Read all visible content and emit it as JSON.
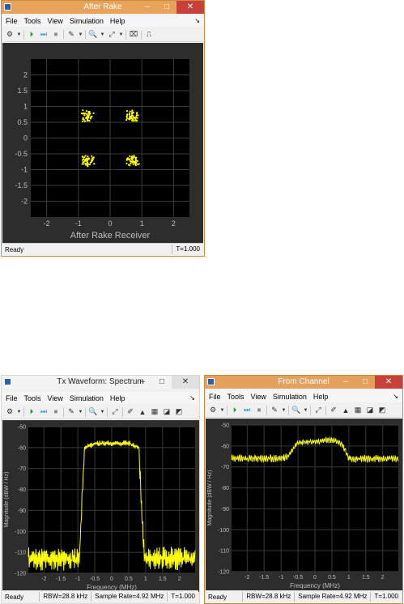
{
  "rake": {
    "title": "After Rake",
    "menu": [
      "File",
      "Tools",
      "View",
      "Simulation",
      "Help"
    ],
    "status": {
      "ready": "Ready",
      "time": "T=1.000"
    },
    "xlabel": "After Rake Receiver",
    "xticks": [
      "-2",
      "-1",
      "0",
      "1",
      "2"
    ],
    "yticks": [
      "2",
      "1.5",
      "1",
      "0.5",
      "0",
      "-0.5",
      "-1",
      "-1.5",
      "-2"
    ],
    "clusters": [
      {
        "x": -0.7,
        "y": 0.7
      },
      {
        "x": 0.7,
        "y": 0.7
      },
      {
        "x": -0.7,
        "y": -0.7
      },
      {
        "x": 0.7,
        "y": -0.7
      }
    ],
    "color": "#ffff00"
  },
  "tx": {
    "title": "Tx Waveform: Spectrum",
    "menu": [
      "File",
      "Tools",
      "View",
      "Simulation",
      "Help"
    ],
    "status": {
      "ready": "Ready",
      "rbw": "RBW=28.8 kHz",
      "rate": "Sample Rate=4.92 MHz",
      "time": "T=1.000"
    },
    "xlabel": "Frequency (MHz)",
    "ylabel": "Magnitude (dBW / Hz)",
    "xticks": [
      "-2",
      "-1.5",
      "-1",
      "-0.5",
      "0",
      "0.5",
      "1",
      "1.5",
      "2"
    ],
    "yticks": [
      "-50",
      "-60",
      "-70",
      "-80",
      "-90",
      "-100",
      "-110",
      "-120"
    ]
  },
  "ch": {
    "title": "From Channel",
    "menu": [
      "File",
      "Tools",
      "View",
      "Simulation",
      "Help"
    ],
    "status": {
      "ready": "Ready",
      "rbw": "RBW=28.8 kHz",
      "rate": "Sample Rate=4.92 MHz",
      "time": "T=1.000"
    },
    "xlabel": "Frequency (MHz)",
    "ylabel": "Magnitude (dBW / Hz)",
    "xticks": [
      "-2",
      "-1.5",
      "-1",
      "-0.5",
      "0",
      "0.5",
      "1",
      "1.5",
      "2"
    ],
    "yticks": [
      "-50",
      "-60",
      "-70",
      "-80",
      "-90",
      "-100",
      "-110",
      "-120"
    ]
  },
  "chart_data": [
    {
      "type": "scatter",
      "title": "",
      "xlabel": "After Rake Receiver",
      "ylabel": "",
      "xlim": [
        -2.5,
        2.5
      ],
      "ylim": [
        -2.5,
        2.5
      ],
      "series": [
        {
          "points_centers": [
            [
              -0.7,
              0.7
            ],
            [
              0.7,
              0.7
            ],
            [
              -0.7,
              -0.7
            ],
            [
              0.7,
              -0.7
            ]
          ]
        }
      ]
    },
    {
      "type": "line",
      "title": "",
      "xlabel": "Frequency (MHz)",
      "ylabel": "Magnitude (dBW / Hz)",
      "xlim": [
        -2.46,
        2.46
      ],
      "ylim": [
        -120,
        -50
      ],
      "series": [
        {
          "x": [
            -2.46,
            -1.0,
            -0.95,
            -0.8,
            -0.5,
            0,
            0.5,
            0.8,
            0.95,
            1.0,
            2.46
          ],
          "values": [
            -113,
            -113,
            -110,
            -60,
            -58,
            -58,
            -58,
            -60,
            -110,
            -113,
            -113
          ]
        }
      ]
    },
    {
      "type": "line",
      "title": "",
      "xlabel": "Frequency (MHz)",
      "ylabel": "Magnitude (dBW / Hz)",
      "xlim": [
        -2.46,
        2.46
      ],
      "ylim": [
        -120,
        -50
      ],
      "series": [
        {
          "x": [
            -2.46,
            -1.0,
            -0.8,
            -0.5,
            0,
            0.5,
            0.8,
            1.0,
            2.46
          ],
          "values": [
            -66,
            -66,
            -65,
            -58,
            -58,
            -57,
            -59,
            -66,
            -66
          ]
        }
      ]
    }
  ]
}
